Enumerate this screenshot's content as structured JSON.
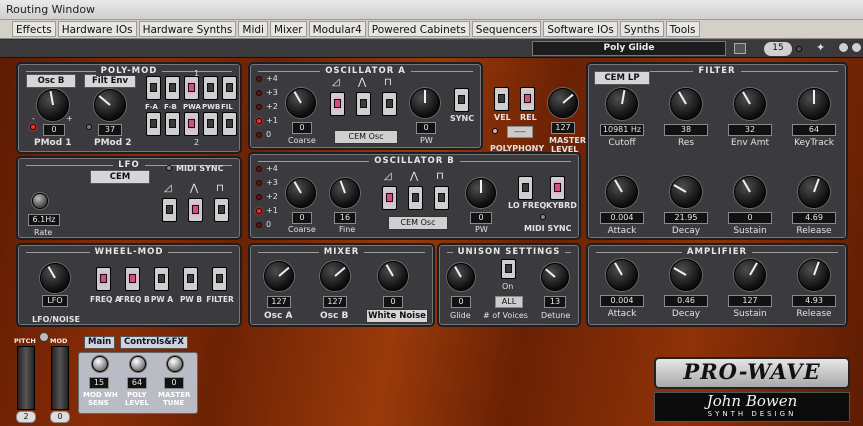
{
  "window": {
    "title": "Routing Window"
  },
  "menu": [
    "Effects",
    "Hardware IOs",
    "Hardware Synths",
    "Midi",
    "Mixer",
    "Modular4",
    "Powered Cabinets",
    "Sequencers",
    "Software IOs",
    "Synths",
    "Tools"
  ],
  "patch": {
    "name": "Poly Glide",
    "number": "15"
  },
  "polymod": {
    "title": "POLY-MOD",
    "src1": "Osc B",
    "src2": "Filt Env",
    "val1": "0",
    "val2": "37",
    "label1": "PMod 1",
    "label2": "PMod 2",
    "minus": "-",
    "plus": "+",
    "dest_labels": [
      "F-A",
      "F-B",
      "PWA",
      "PWB",
      "FIL"
    ],
    "row1": "1",
    "row2": "2"
  },
  "oscA": {
    "title": "OSCILLATOR A",
    "octaves": [
      "+4",
      "+3",
      "+2",
      "+1",
      "0"
    ],
    "coarse": "0",
    "coarse_label": "Coarse",
    "type": "CEM Osc",
    "pw": "0",
    "pw_label": "PW",
    "sync": "SYNC"
  },
  "voice": {
    "vel": "VEL",
    "rel": "REL",
    "poly_value": "----",
    "poly_label": "POLYPHONY",
    "master": "127",
    "master_label1": "MASTER",
    "master_label2": "LEVEL"
  },
  "lfo": {
    "title": "LFO",
    "type": "CEM",
    "midisync": "MIDI SYNC",
    "rate": "6.1Hz",
    "rate_label": "Rate"
  },
  "oscB": {
    "title": "OSCILLATOR B",
    "octaves": [
      "+4",
      "+3",
      "+2",
      "+1",
      "0"
    ],
    "coarse": "0",
    "coarse_label": "Coarse",
    "fine": "16",
    "fine_label": "Fine",
    "type": "CEM Osc",
    "pw": "0",
    "pw_label": "PW",
    "lofreq": "LO FREQ",
    "kybrd": "KYBRD",
    "midisync": "MIDI SYNC"
  },
  "filter": {
    "title": "FILTER",
    "type": "CEM LP",
    "cutoff": "10981 Hz",
    "cutoff_label": "Cutoff",
    "res": "38",
    "res_label": "Res",
    "envamt": "32",
    "envamt_label": "Env Amt",
    "keytrack": "64",
    "keytrack_label": "KeyTrack",
    "attack": "0.004",
    "attack_label": "Attack",
    "decay": "21.95",
    "decay_label": "Decay",
    "sustain": "0",
    "sustain_label": "Sustain",
    "release": "4.69",
    "release_label": "Release"
  },
  "wheelmod": {
    "title": "WHEEL-MOD",
    "src": "LFO",
    "src_label": "LFO/NOISE",
    "dests": [
      "FREQ A",
      "FREQ B",
      "PW A",
      "PW B",
      "FILTER"
    ]
  },
  "mixer": {
    "title": "MIXER",
    "oscA": "127",
    "oscA_label": "Osc A",
    "oscB": "127",
    "oscB_label": "Osc B",
    "noise": "0",
    "noise_label": "White Noise"
  },
  "unison": {
    "title": "UNISON SETTINGS",
    "glide": "0",
    "glide_label": "Glide",
    "on": "On",
    "voices": "ALL",
    "voices_label": "# of Voices",
    "detune": "13",
    "detune_label": "Detune"
  },
  "amp": {
    "title": "AMPLIFIER",
    "attack": "0.004",
    "attack_label": "Attack",
    "decay": "0.46",
    "decay_label": "Decay",
    "sustain": "127",
    "sustain_label": "Sustain",
    "release": "4.93",
    "release_label": "Release"
  },
  "bottom": {
    "pitch": "PITCH",
    "mod": "MOD",
    "pitch_val": "2",
    "mod_val": "0",
    "tab_main": "Main",
    "tab_controls": "Controls&FX",
    "modwh": "15",
    "modwh_label1": "MOD WH",
    "modwh_label2": "SENS",
    "poly": "64",
    "poly_label1": "POLY",
    "poly_label2": "LEVEL",
    "tune": "0",
    "tune_label1": "MASTER",
    "tune_label2": "TUNE"
  },
  "brand": {
    "logo": "PRO-WAVE",
    "maker": "John Bowen",
    "maker_sub": "SYNTH DESIGN"
  }
}
